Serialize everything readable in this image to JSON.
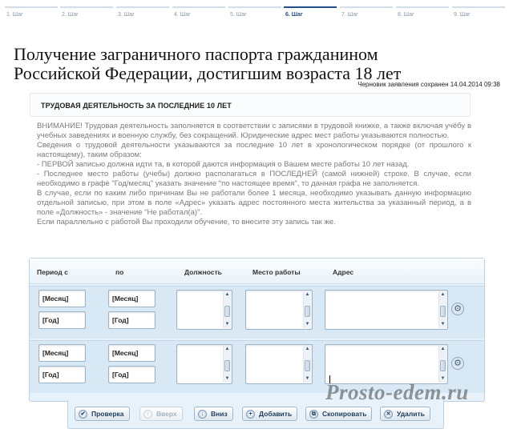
{
  "steps": [
    {
      "label": "1. Шаг",
      "active": false
    },
    {
      "label": "2. Шаг",
      "active": false
    },
    {
      "label": "3. Шаг",
      "active": false
    },
    {
      "label": "4. Шаг",
      "active": false
    },
    {
      "label": "5. Шаг",
      "active": false
    },
    {
      "label": "6. Шаг",
      "active": true
    },
    {
      "label": "7. Шаг",
      "active": false
    },
    {
      "label": "8. Шаг",
      "active": false
    },
    {
      "label": "9. Шаг",
      "active": false
    }
  ],
  "page": {
    "title_line1": "Получение заграничного паспорта гражданином",
    "title_line2": "Российской Федерации, достигшим возраста 18 лет",
    "saved_note": "Черновик заявления сохранен 14.04.2014 09:38"
  },
  "section": {
    "title": "ТРУДОВАЯ ДЕЯТЕЛЬНОСТЬ ЗА ПОСЛЕДНИЕ 10 ЛЕТ",
    "notice": [
      "ВНИМАНИЕ! Трудовая деятельность заполняется в соответствии с записями в трудовой книжке, а также включая учёбу в учебных заведениях и военную службу, без сокращений. Юридические адрес мест работы указываются полностью.",
      "Сведения о трудовой деятельности указываются за последние 10 лет в хронологическом порядке (от прошлого к настоящему), таким образом:",
      "- ПЕРВОЙ записью должна идти та, в которой даются информация о Вашем месте работы 10 лет назад.",
      "- Последнее место работы (учебы) должно располагаться в ПОСЛЕДНЕЙ (самой нижней) строке. В случае, если необходимо в графе \"Год/месяц\" указать значение \"по настоящее время\", то данная графа не заполняется.",
      "В случае, если по каким либо причинам Вы не работали более 1 месяца, необходимо указывать данную информацию отдельной записью, при этом в поле «Адрес» указать адрес постоянного места жительства за указанный период, а в поле «Должность» - значение \"Не работал(а)\".",
      "Если параллельно с работой Вы проходили обучение, то внесите эту запись так же."
    ]
  },
  "table": {
    "headers": {
      "from": "Период с",
      "to": "по",
      "position": "Должность",
      "workplace": "Место работы",
      "address": "Адрес"
    },
    "rows": [
      {
        "from_month": "[Месяц]",
        "from_year": "[Год]",
        "to_month": "[Месяц]",
        "to_year": "[Год]"
      },
      {
        "from_month": "[Месяц]",
        "from_year": "[Год]",
        "to_month": "[Месяц]",
        "to_year": "[Год]"
      }
    ]
  },
  "toolbar": {
    "check": "Проверка",
    "up": "Вверх",
    "down": "Вниз",
    "add": "Добавить",
    "copy": "Скопировать",
    "delete": "Удалить"
  },
  "watermark": "Prosto-edem.ru",
  "icons": {
    "check": "check-icon",
    "up": "arrow-up-icon",
    "down": "arrow-down-icon",
    "add": "plus-icon",
    "copy": "copy-icon",
    "delete": "close-icon",
    "row_settings": "gear-icon"
  }
}
